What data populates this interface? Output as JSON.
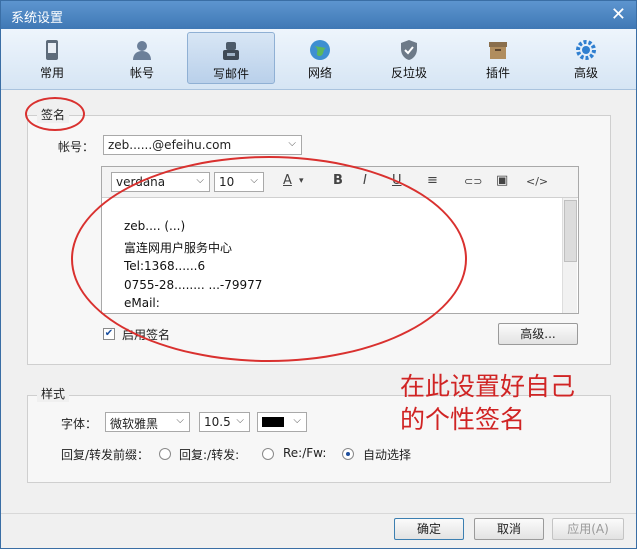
{
  "window": {
    "title": "系统设置",
    "close_glyph": "✕"
  },
  "toolbar": {
    "items": [
      {
        "label": "常用",
        "icon": "device-icon"
      },
      {
        "label": "帐号",
        "icon": "user-icon"
      },
      {
        "label": "写邮件",
        "icon": "write-mail-icon"
      },
      {
        "label": "网络",
        "icon": "globe-icon"
      },
      {
        "label": "反垃圾",
        "icon": "shield-icon"
      },
      {
        "label": "插件",
        "icon": "box-icon"
      },
      {
        "label": "高级",
        "icon": "gear-icon"
      }
    ],
    "active_index": 2
  },
  "signature": {
    "group_title": "签名",
    "account_label": "帐号：",
    "account_value": "zeb......@efeihu.com",
    "font_value": "verdana",
    "size_value": "10",
    "tool_color": "A",
    "tool_bold": "B",
    "tool_italic": "I",
    "tool_underline": "U",
    "tool_align": "≡",
    "tool_link": "⊂⊃",
    "tool_image": "▣",
    "tool_code": "</>",
    "lines": [
      "zeb.... (...)",
      "富连网用户服务中心",
      "Tel:1368......6",
      "0755-28........ ...-79977",
      "eMail:"
    ],
    "enable_label": "启用签名",
    "enable_checked": true,
    "advanced_button": "高级..."
  },
  "style": {
    "group_title": "样式",
    "font_label": "字体：",
    "font_value": "微软雅黑",
    "size_value": "10.5",
    "reply_label": "回复/转发前缀：",
    "options": [
      "回复:/转发:",
      "Re:/Fw:",
      "自动选择"
    ],
    "selected_option": 2
  },
  "annotation": {
    "line1": "在此设置好自己",
    "line2": "的个性签名"
  },
  "buttons": {
    "ok": "确定",
    "cancel": "取消",
    "apply": "应用(A)"
  },
  "colors": {
    "accent_red": "#d9312f",
    "title_blue": "#3f78b5"
  }
}
